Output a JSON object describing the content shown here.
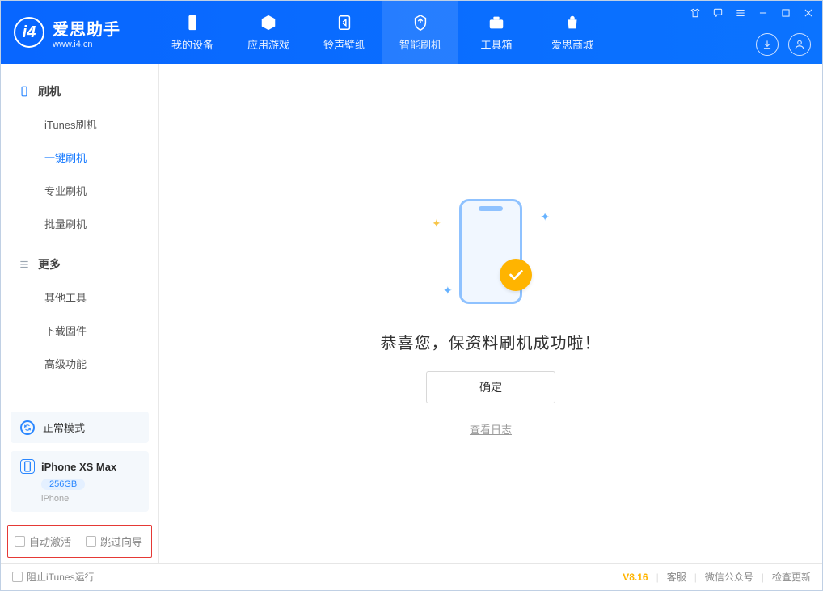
{
  "app": {
    "name": "爱思助手",
    "url": "www.i4.cn"
  },
  "nav": {
    "tabs": [
      {
        "label": "我的设备",
        "icon": "device-icon"
      },
      {
        "label": "应用游戏",
        "icon": "apps-icon"
      },
      {
        "label": "铃声壁纸",
        "icon": "ringtone-icon"
      },
      {
        "label": "智能刷机",
        "icon": "flash-icon",
        "active": true
      },
      {
        "label": "工具箱",
        "icon": "toolbox-icon"
      },
      {
        "label": "爱思商城",
        "icon": "store-icon"
      }
    ]
  },
  "sidebar": {
    "groups": [
      {
        "title": "刷机",
        "icon": "phone-icon",
        "items": [
          {
            "label": "iTunes刷机"
          },
          {
            "label": "一键刷机",
            "active": true
          },
          {
            "label": "专业刷机"
          },
          {
            "label": "批量刷机"
          }
        ]
      },
      {
        "title": "更多",
        "icon": "menu-icon",
        "items": [
          {
            "label": "其他工具"
          },
          {
            "label": "下载固件"
          },
          {
            "label": "高级功能"
          }
        ]
      }
    ],
    "mode": {
      "label": "正常模式"
    },
    "device": {
      "name": "iPhone XS Max",
      "capacity": "256GB",
      "type": "iPhone"
    },
    "options": {
      "auto_activate": "自动激活",
      "skip_guide": "跳过向导"
    }
  },
  "main": {
    "success_message": "恭喜您，保资料刷机成功啦！",
    "confirm": "确定",
    "view_log": "查看日志"
  },
  "footer": {
    "block_itunes": "阻止iTunes运行",
    "version": "V8.16",
    "links": [
      "客服",
      "微信公众号",
      "检查更新"
    ]
  }
}
